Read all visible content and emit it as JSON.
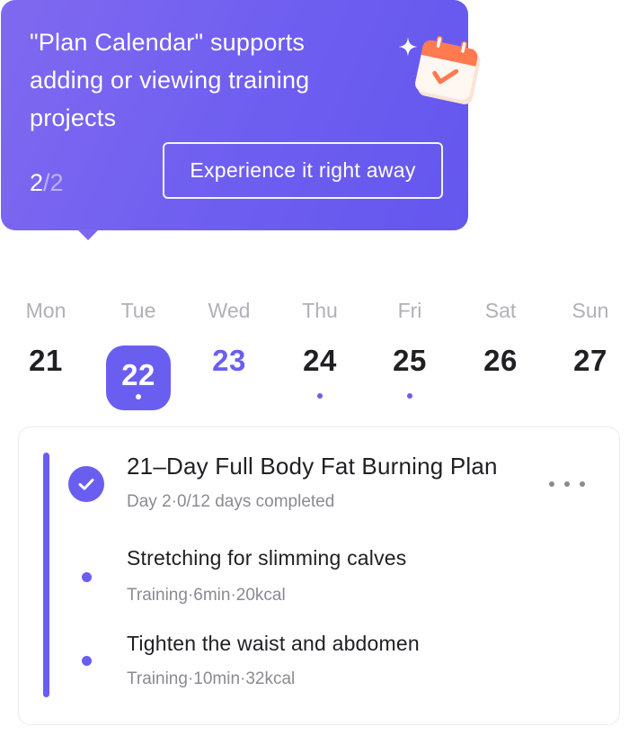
{
  "tooltip": {
    "message": "\"Plan Calendar\" supports adding or viewing training projects",
    "step_current": "2",
    "step_separator": "/",
    "step_total": "2",
    "cta_label": "Experience it right away",
    "icons": [
      "sparkle-icon",
      "calendar-check-icon"
    ]
  },
  "week": {
    "days": [
      {
        "name": "Mon",
        "number": "21"
      },
      {
        "name": "Tue",
        "number": "22"
      },
      {
        "name": "Wed",
        "number": "23"
      },
      {
        "name": "Thu",
        "number": "24"
      },
      {
        "name": "Fri",
        "number": "25"
      },
      {
        "name": "Sat",
        "number": "26"
      },
      {
        "name": "Sun",
        "number": "27"
      }
    ]
  },
  "plan": {
    "title": "21–Day Full Body Fat Burning Plan",
    "subtitle": "Day 2·0/12 days completed",
    "items": [
      {
        "title": "Stretching for slimming calves",
        "meta": "Training·6min·20kcal"
      },
      {
        "title": "Tighten the waist and abdomen",
        "meta": "Training·10min·32kcal"
      }
    ]
  },
  "colors": {
    "accent": "#6a5ef1",
    "tooltip_gradient_start": "#8069f0",
    "tooltip_gradient_end": "#6457ee",
    "muted_text": "#8a8a92",
    "calendar_icon_orange": "#ff7a50"
  }
}
